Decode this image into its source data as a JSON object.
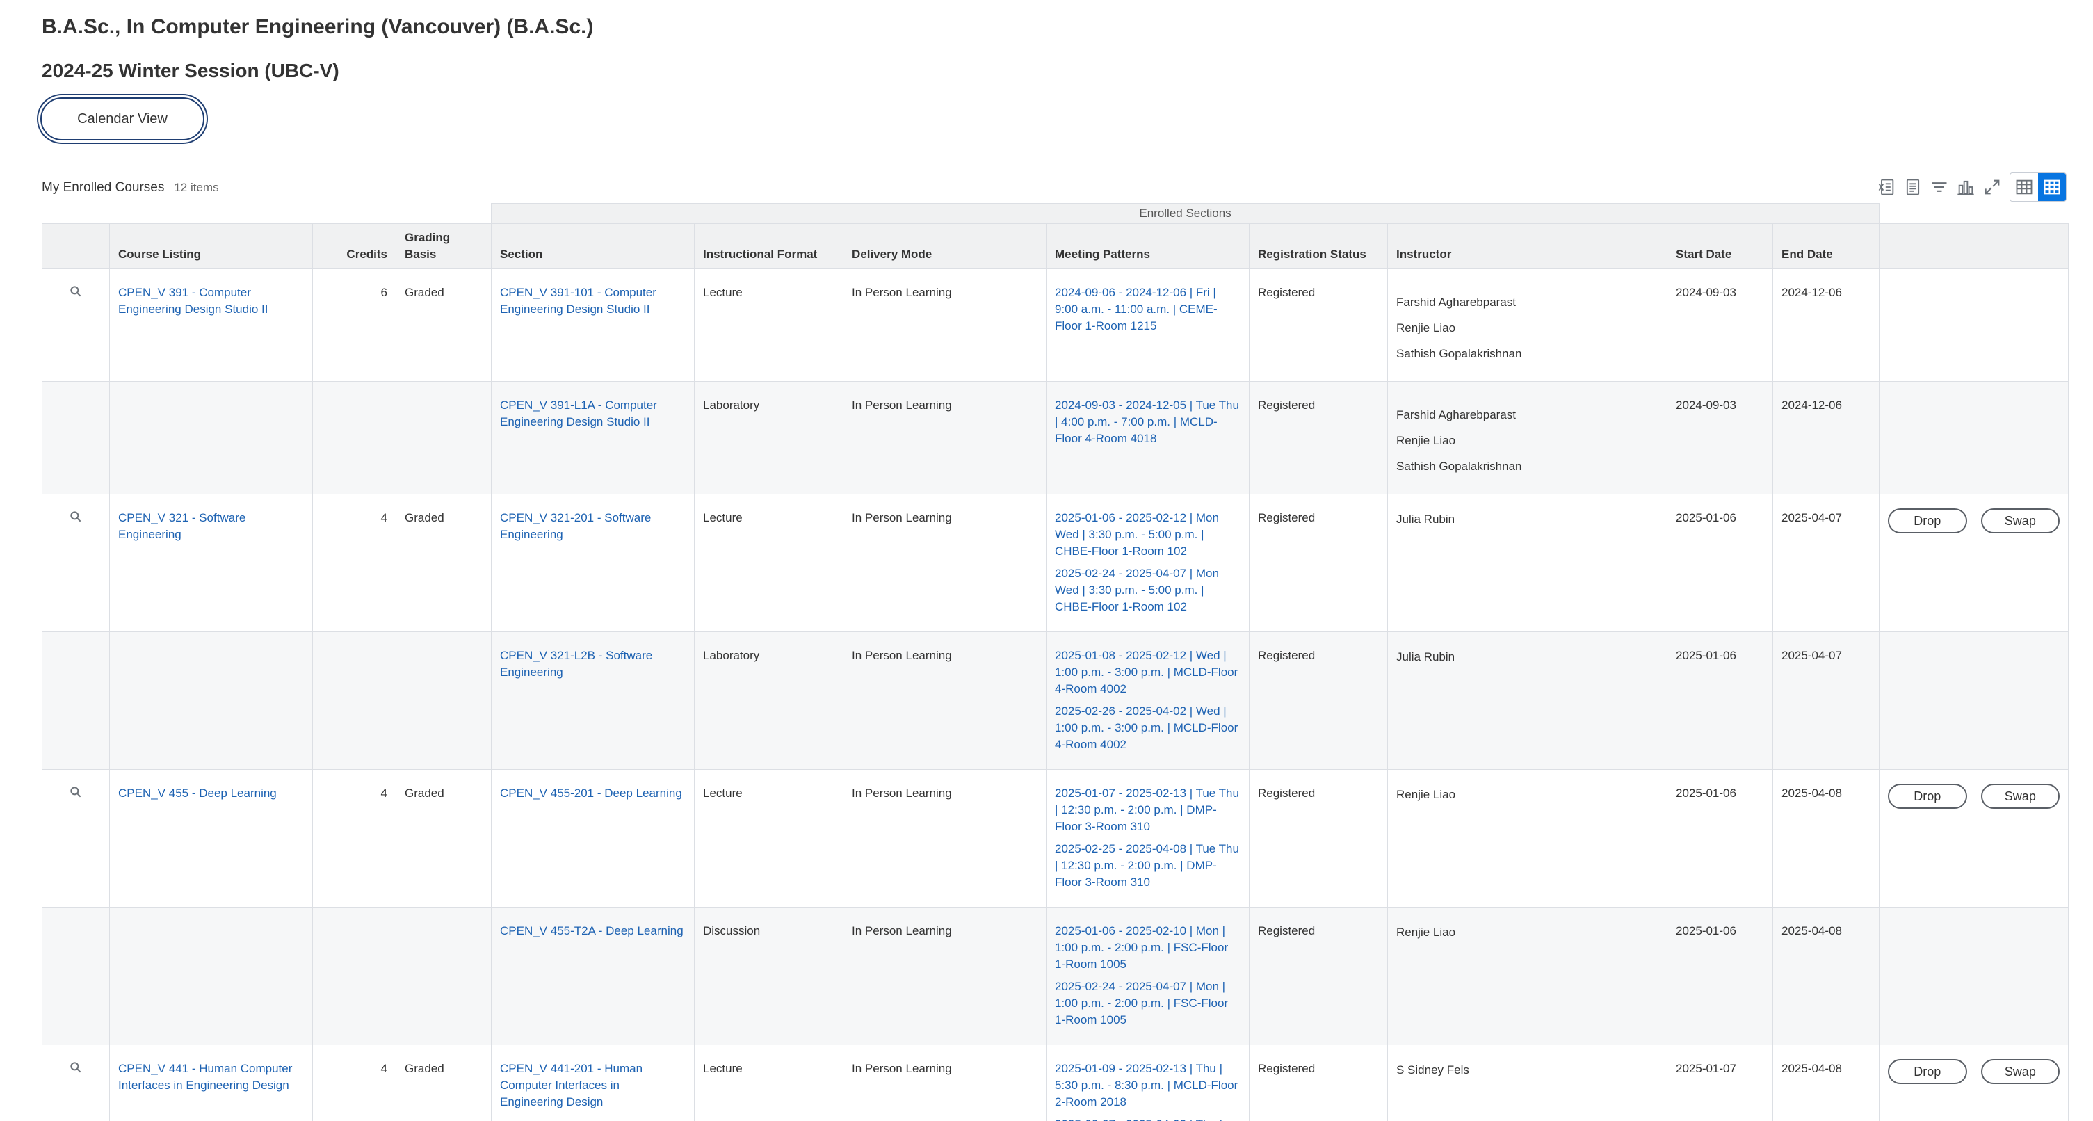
{
  "header": {
    "program_title": "B.A.Sc., In Computer Engineering (Vancouver) (B.A.Sc.)",
    "session_title": "2024-25 Winter Session (UBC-V)",
    "calendar_view_label": "Calendar View"
  },
  "grid": {
    "title": "My Enrolled Courses",
    "count": "12 items",
    "group_header": "Enrolled Sections",
    "columns": {
      "course_listing": "Course Listing",
      "credits": "Credits",
      "grading_basis": "Grading Basis",
      "section": "Section",
      "instructional_format": "Instructional Format",
      "delivery_mode": "Delivery Mode",
      "meeting_patterns": "Meeting Patterns",
      "registration_status": "Registration Status",
      "instructor": "Instructor",
      "start_date": "Start Date",
      "end_date": "End Date"
    },
    "toolbar_icons": [
      "export-to-excel-icon",
      "export-to-pdf-icon",
      "filter-icon",
      "chart-icon",
      "fullscreen-icon",
      "table-view-icon",
      "grid-view-icon"
    ],
    "action_labels": {
      "drop": "Drop",
      "swap": "Swap"
    },
    "rows": [
      {
        "course": "CPEN_V 391 - Computer Engineering Design Studio II",
        "credits": "6",
        "grading": "Graded",
        "section": "CPEN_V 391-101 - Computer Engineering Design Studio II",
        "format": "Lecture",
        "delivery": "In Person Learning",
        "patterns": [
          "2024-09-06 - 2024-12-06 | Fri | 9:00 a.m. - 11:00 a.m. | CEME-Floor 1-Room 1215"
        ],
        "status": "Registered",
        "instructors": [
          "Farshid Agharebparast",
          "Renjie Liao",
          "Sathish Gopalakrishnan"
        ],
        "start": "2024-09-03",
        "end": "2024-12-06",
        "has_actions": false
      },
      {
        "course": "",
        "credits": "",
        "grading": "",
        "section": "CPEN_V 391-L1A - Computer Engineering Design Studio II",
        "format": "Laboratory",
        "delivery": "In Person Learning",
        "patterns": [
          "2024-09-03 - 2024-12-05 | Tue Thu | 4:00 p.m. - 7:00 p.m. | MCLD-Floor 4-Room 4018"
        ],
        "status": "Registered",
        "instructors": [
          "Farshid Agharebparast",
          "Renjie Liao",
          "Sathish Gopalakrishnan"
        ],
        "start": "2024-09-03",
        "end": "2024-12-06",
        "has_actions": false
      },
      {
        "course": "CPEN_V 321 - Software Engineering",
        "credits": "4",
        "grading": "Graded",
        "section": "CPEN_V 321-201 - Software Engineering",
        "format": "Lecture",
        "delivery": "In Person Learning",
        "patterns": [
          "2025-01-06 - 2025-02-12 | Mon Wed | 3:30 p.m. - 5:00 p.m. | CHBE-Floor 1-Room 102",
          "2025-02-24 - 2025-04-07 | Mon Wed | 3:30 p.m. - 5:00 p.m. | CHBE-Floor 1-Room 102"
        ],
        "status": "Registered",
        "instructors": [
          "Julia Rubin"
        ],
        "start": "2025-01-06",
        "end": "2025-04-07",
        "has_actions": true
      },
      {
        "course": "",
        "credits": "",
        "grading": "",
        "section": "CPEN_V 321-L2B - Software Engineering",
        "format": "Laboratory",
        "delivery": "In Person Learning",
        "patterns": [
          "2025-01-08 - 2025-02-12 | Wed | 1:00 p.m. - 3:00 p.m. | MCLD-Floor 4-Room 4002",
          "2025-02-26 - 2025-04-02 | Wed | 1:00 p.m. - 3:00 p.m. | MCLD-Floor 4-Room 4002"
        ],
        "status": "Registered",
        "instructors": [
          "Julia Rubin"
        ],
        "start": "2025-01-06",
        "end": "2025-04-07",
        "has_actions": false
      },
      {
        "course": "CPEN_V 455 - Deep Learning",
        "credits": "4",
        "grading": "Graded",
        "section": "CPEN_V 455-201 - Deep Learning",
        "format": "Lecture",
        "delivery": "In Person Learning",
        "patterns": [
          "2025-01-07 - 2025-02-13 | Tue Thu | 12:30 p.m. - 2:00 p.m. | DMP-Floor 3-Room 310",
          "2025-02-25 - 2025-04-08 | Tue Thu | 12:30 p.m. - 2:00 p.m. | DMP-Floor 3-Room 310"
        ],
        "status": "Registered",
        "instructors": [
          "Renjie Liao"
        ],
        "start": "2025-01-06",
        "end": "2025-04-08",
        "has_actions": true
      },
      {
        "course": "",
        "credits": "",
        "grading": "",
        "section": "CPEN_V 455-T2A - Deep Learning",
        "format": "Discussion",
        "delivery": "In Person Learning",
        "patterns": [
          "2025-01-06 - 2025-02-10 | Mon | 1:00 p.m. - 2:00 p.m. | FSC-Floor 1-Room 1005",
          "2025-02-24 - 2025-04-07 | Mon | 1:00 p.m. - 2:00 p.m. | FSC-Floor 1-Room 1005"
        ],
        "status": "Registered",
        "instructors": [
          "Renjie Liao"
        ],
        "start": "2025-01-06",
        "end": "2025-04-08",
        "has_actions": false
      },
      {
        "course": "CPEN_V 441 - Human Computer Interfaces in Engineering Design",
        "credits": "4",
        "grading": "Graded",
        "section": "CPEN_V 441-201 - Human Computer Interfaces in Engineering Design",
        "format": "Lecture",
        "delivery": "In Person Learning",
        "patterns": [
          "2025-01-09 - 2025-02-13 | Thu | 5:30 p.m. - 8:30 p.m. | MCLD-Floor 2-Room 2018",
          "2025-02-27 - 2025-04-03 | Thu |"
        ],
        "status": "Registered",
        "instructors": [
          "S Sidney Fels"
        ],
        "start": "2025-01-07",
        "end": "2025-04-08",
        "has_actions": true
      }
    ]
  }
}
